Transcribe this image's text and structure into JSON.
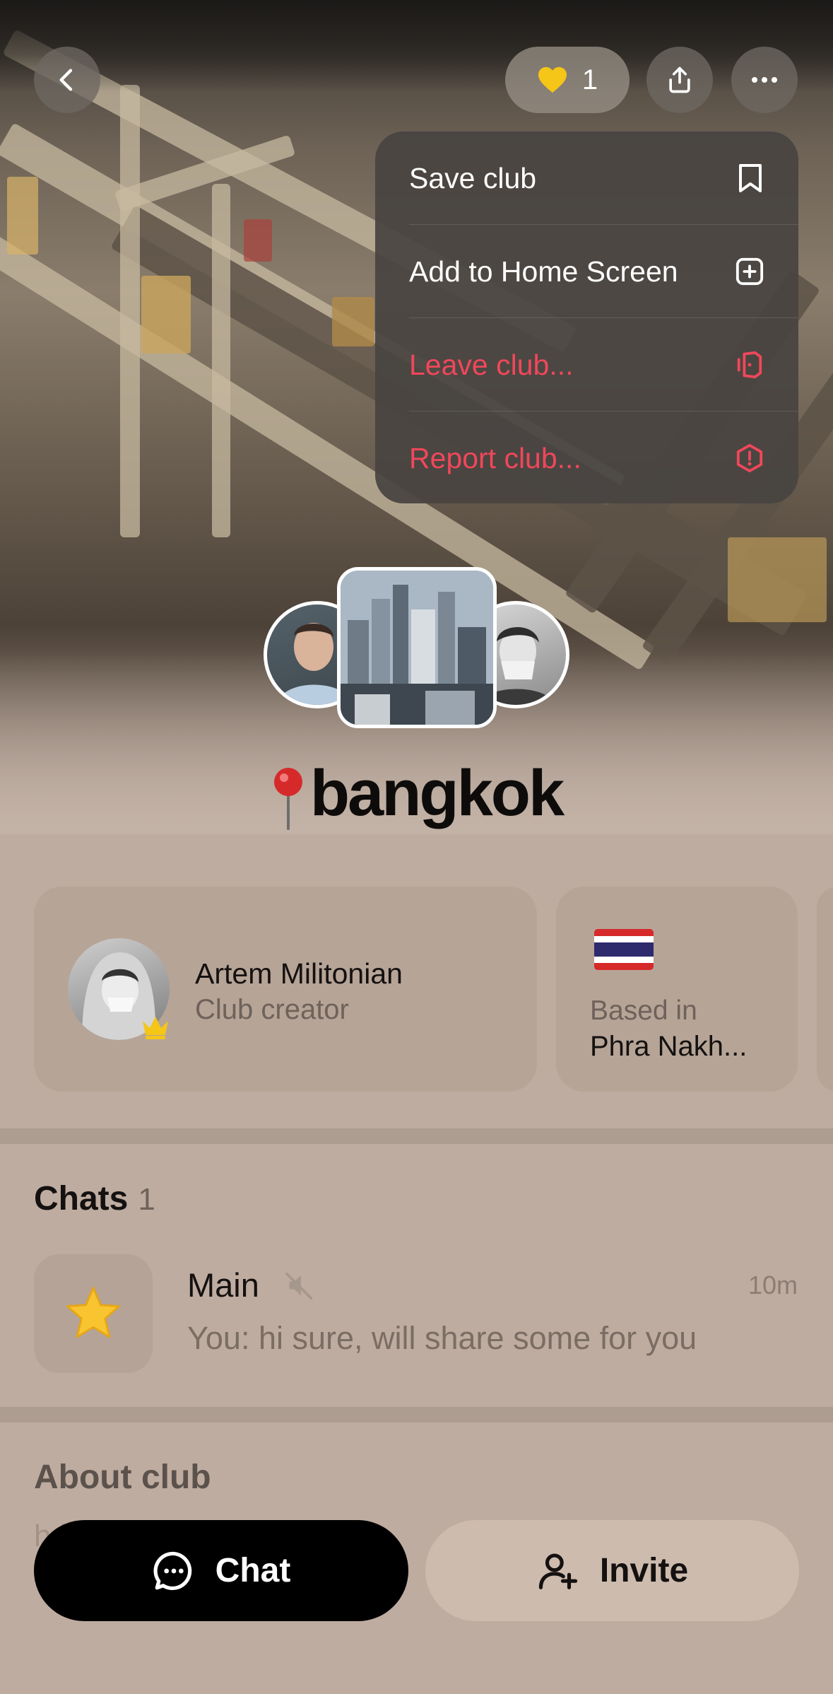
{
  "header": {
    "like_count": "1"
  },
  "menu": {
    "items": [
      {
        "label": "Save club",
        "icon": "bookmark-icon",
        "danger": false
      },
      {
        "label": "Add to Home Screen",
        "icon": "plus-square-icon",
        "danger": false
      },
      {
        "label": "Leave club...",
        "icon": "leave-icon",
        "danger": true
      },
      {
        "label": "Report club...",
        "icon": "alert-hexagon-icon",
        "danger": true
      }
    ]
  },
  "club": {
    "title_emoji": "pin-icon",
    "title": "bangkok"
  },
  "creator": {
    "name": "Artem Militonian",
    "role": "Club creator"
  },
  "location": {
    "flag": "thailand-flag",
    "label": "Based in",
    "value": "Phra Nakh..."
  },
  "chats": {
    "title": "Chats",
    "count": "1",
    "items": [
      {
        "name": "Main",
        "time": "10m",
        "preview": "You: hi sure, will share some for you",
        "icon": "star-icon",
        "muted": true
      }
    ]
  },
  "about": {
    "title": "About club",
    "peek": "h                       ki"
  },
  "actions": {
    "chat_label": "Chat",
    "invite_label": "Invite"
  },
  "colors": {
    "background": "#bfaca0",
    "danger": "#f0475a",
    "like": "#f5c518"
  }
}
